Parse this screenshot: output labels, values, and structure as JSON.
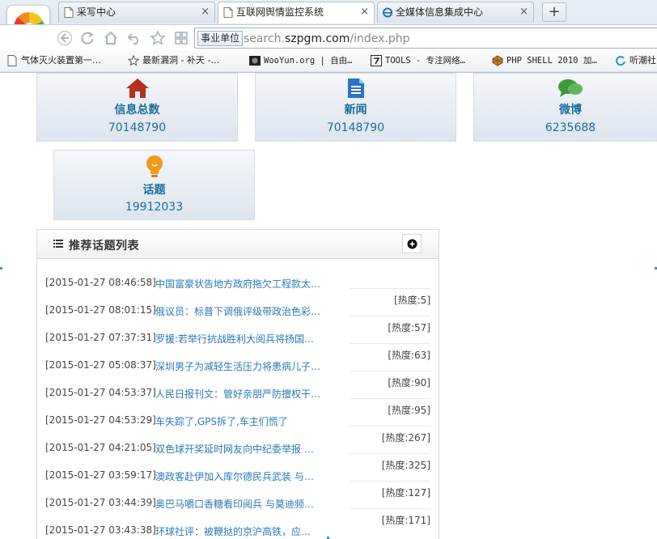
{
  "browser": {
    "tabs": [
      {
        "label": "采写中心",
        "active": false
      },
      {
        "label": "互联网舆情监控系统",
        "active": true
      },
      {
        "label": "全媒体信息集成中心",
        "active": false
      }
    ],
    "close_glyph": "×",
    "new_tab_glyph": "+",
    "address": {
      "badge": "事业单位",
      "url_prefix": "search.",
      "url_domain": "szpgm.com",
      "url_path": "/index.php"
    },
    "bookmarks": [
      {
        "label": "气体灭火装置第一…",
        "icon": "page-icon"
      },
      {
        "label": "最新漏洞 - 补天 -…",
        "icon": "star-icon"
      },
      {
        "label": "WooYun.org | 自由…",
        "icon": "wooyun-icon"
      },
      {
        "label": "TOOLS - 专注网络…",
        "icon": "tools-icon"
      },
      {
        "label": "PHP SHELL 2010 加…",
        "icon": "php-icon"
      },
      {
        "label": "听潮社",
        "icon": "refresh-icon"
      }
    ]
  },
  "stats": [
    {
      "label": "信息总数",
      "value": "70148790",
      "icon": "home-icon"
    },
    {
      "label": "新闻",
      "value": "70148790",
      "icon": "document-icon"
    },
    {
      "label": "微博",
      "value": "6235688",
      "icon": "chat-icon"
    },
    {
      "label": "话题",
      "value": "19912033",
      "icon": "lightbulb-icon"
    }
  ],
  "topics_panel": {
    "title": "推荐话题列表",
    "items": [
      {
        "time": "[2015-01-27 08:46:58]",
        "title": "中国富豪状告地方政府拖欠工程款太…",
        "heat": ""
      },
      {
        "time": "[2015-01-27 08:01:15]",
        "title": "俄议员：标普下调俄评级带政治色彩…",
        "heat": "[热度:5]"
      },
      {
        "time": "[2015-01-27 07:37:31]",
        "title": "罗援:若举行抗战胜利大阅兵将扬国…",
        "heat": "[热度:57]"
      },
      {
        "time": "[2015-01-27 05:08:37]",
        "title": "深圳男子为减轻生活压力将患病儿子…",
        "heat": "[热度:63]"
      },
      {
        "time": "[2015-01-27 04:53:37]",
        "title": "人民日报刊文：管好亲朋严防擅权干…",
        "heat": "[热度:90]"
      },
      {
        "time": "[2015-01-27 04:53:29]",
        "title": "车失踪了,GPS拆了,车主们慌了",
        "heat": "[热度:95]"
      },
      {
        "time": "[2015-01-27 04:21:05]",
        "title": "双色球开奖延时网友向中纪委举报 …",
        "heat": "[热度:267]"
      },
      {
        "time": "[2015-01-27 03:59:17]",
        "title": "澳政客赴伊加入库尔德民兵武装 与…",
        "heat": "[热度:325]"
      },
      {
        "time": "[2015-01-27 03:44:39]",
        "title": "奥巴马嚼口香糖看印阅兵 与莫迪频…",
        "heat": "[热度:127]"
      },
      {
        "time": "[2015-01-27 03:43:38]",
        "title": "环球社评：被鞭挞的京沪高铁，应…",
        "heat": "[热度:171]"
      }
    ]
  },
  "colors": {
    "accent": "#1a6ea0",
    "link": "#2a7ab0",
    "home_icon": "#b5301f",
    "doc_icon": "#2b72c4",
    "chat_icon": "#3c9a3c",
    "bulb_icon": "#f29a1a"
  }
}
